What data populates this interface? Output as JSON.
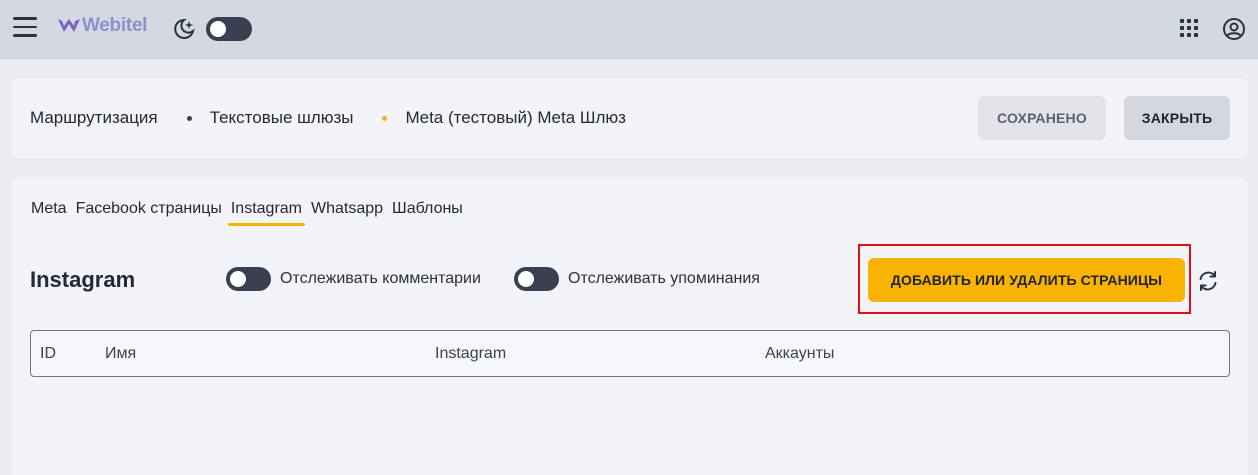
{
  "topbar": {
    "logo_text": "Webitel",
    "icons": [
      "menu-icon",
      "webitel-logo",
      "dark-mode-icon",
      "apps-grid-icon",
      "account-icon"
    ],
    "theme_toggle_on": false
  },
  "breadcrumb": {
    "items": [
      "Маршрутизация",
      "Текстовые шлюзы",
      "Meta (тестовый) Meta Шлюз"
    ],
    "dot_colors": [
      "#3a3f52",
      "#f6b400"
    ]
  },
  "actions": {
    "saved_label": "СОХРАНЕНО",
    "close_label": "ЗАКРЫТЬ"
  },
  "tabs": [
    {
      "label": "Meta",
      "active": false
    },
    {
      "label": "Facebook страницы",
      "active": false
    },
    {
      "label": "Instagram",
      "active": true
    },
    {
      "label": "Whatsapp",
      "active": false
    },
    {
      "label": "Шаблоны",
      "active": false
    }
  ],
  "section": {
    "title": "Instagram",
    "toggle_comments_label": "Отслеживать комментарии",
    "toggle_comments_on": false,
    "toggle_mentions_label": "Отслеживать упоминания",
    "toggle_mentions_on": false,
    "add_button_label": "ДОБАВИТЬ ИЛИ УДАЛИТЬ СТРАНИЦЫ"
  },
  "table": {
    "columns": [
      "ID",
      "Имя",
      "Instagram",
      "Аккаунты"
    ],
    "rows": []
  },
  "colors": {
    "accent": "#f9b300",
    "highlight": "#e0101a",
    "topbar": "#d4d8e1",
    "card": "#f3f4f8"
  }
}
